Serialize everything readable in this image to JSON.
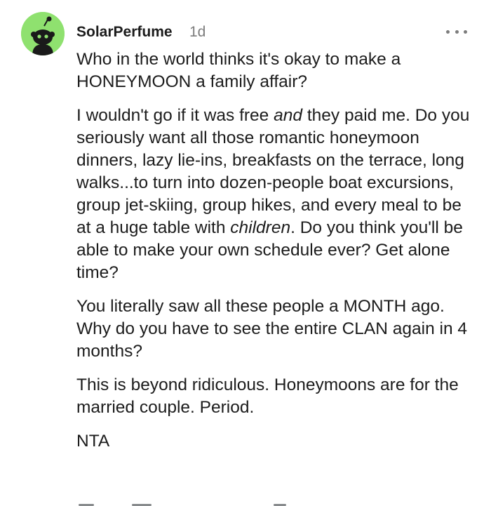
{
  "comment": {
    "author": "SolarPerfume",
    "age": "1d",
    "paragraphs": {
      "p1": "Who in the world thinks it's okay to make a HONEYMOON a family affair?",
      "p2_a": "I wouldn't go if it was free ",
      "p2_em1": "and",
      "p2_b": " they paid me. Do you seriously want all those romantic honeymoon dinners, lazy lie-ins, breakfasts on the terrace, long walks...to turn into dozen-people boat excursions, group jet-skiing, group hikes, and every meal to be at a huge table with ",
      "p2_em2": "children",
      "p2_c": ". Do you think you'll be able to make your own schedule ever? Get alone time?",
      "p3": "You literally saw all these people a MONTH ago. Why do you have to see the entire CLAN again in 4 months?",
      "p4": "This is beyond ridiculous. Honeymoons are for the married couple. Period.",
      "p5": "NTA"
    }
  },
  "icons": {
    "avatar": "snoo-avatar-icon",
    "more": "more-options-icon"
  },
  "colors": {
    "avatar_bg": "#8fe16f",
    "text": "#1c1c1c",
    "muted": "#7c7c7c"
  }
}
